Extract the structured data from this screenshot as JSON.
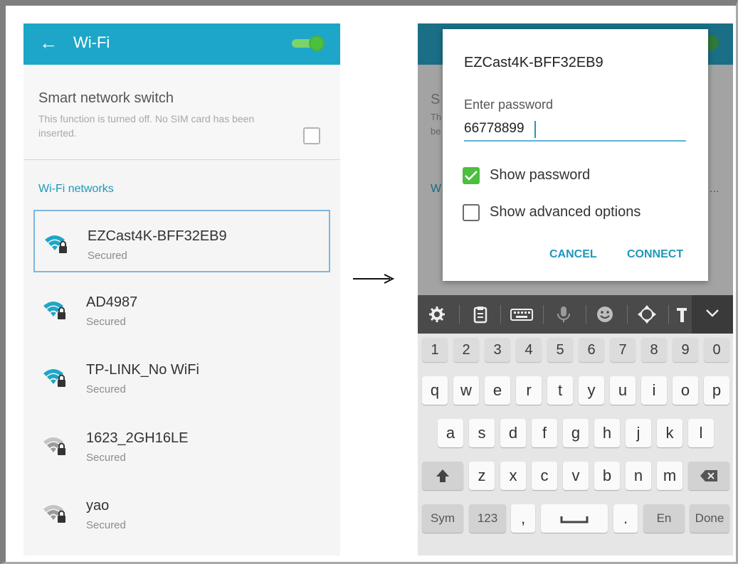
{
  "left": {
    "appbar": {
      "back": "←",
      "title": "Wi-Fi"
    },
    "smart": {
      "title": "Smart network switch",
      "desc": "This function is turned off. No SIM card has been inserted."
    },
    "section": "Wi-Fi networks",
    "networks": [
      {
        "name": "EZCast4K-BFF32EB9",
        "status": "Secured",
        "strength": "full"
      },
      {
        "name": "AD4987",
        "status": "Secured",
        "strength": "full"
      },
      {
        "name": "TP-LINK_No WiFi",
        "status": "Secured",
        "strength": "full"
      },
      {
        "name": "1623_2GH16LE",
        "status": "Secured",
        "strength": "weak"
      },
      {
        "name": "yao",
        "status": "Secured",
        "strength": "weak"
      }
    ]
  },
  "arrow": "→",
  "right": {
    "dim_fragments": {
      "s": "S",
      "th": "Th",
      "be": "be",
      "w": "W",
      "ellipsis": "..."
    },
    "dialog": {
      "title": "EZCast4K-BFF32EB9",
      "password_label": "Enter password",
      "password_value": "66778899",
      "show_password": "Show password",
      "show_advanced": "Show advanced options",
      "cancel": "CANCEL",
      "connect": "CONNECT"
    },
    "keyboard": {
      "numbers": [
        "1",
        "2",
        "3",
        "4",
        "5",
        "6",
        "7",
        "8",
        "9",
        "0"
      ],
      "row1": [
        "q",
        "w",
        "e",
        "r",
        "t",
        "y",
        "u",
        "i",
        "o",
        "p"
      ],
      "row2": [
        "a",
        "s",
        "d",
        "f",
        "g",
        "h",
        "j",
        "k",
        "l"
      ],
      "row3": [
        "z",
        "x",
        "c",
        "v",
        "b",
        "n",
        "m"
      ],
      "sym": "Sym",
      "num123": "123",
      "comma": ",",
      "period": ".",
      "lang": "En",
      "done": "Done"
    }
  },
  "colors": {
    "accent": "#1ea6c8",
    "toggle_on": "#4cbe40",
    "link": "#1e98b9"
  }
}
